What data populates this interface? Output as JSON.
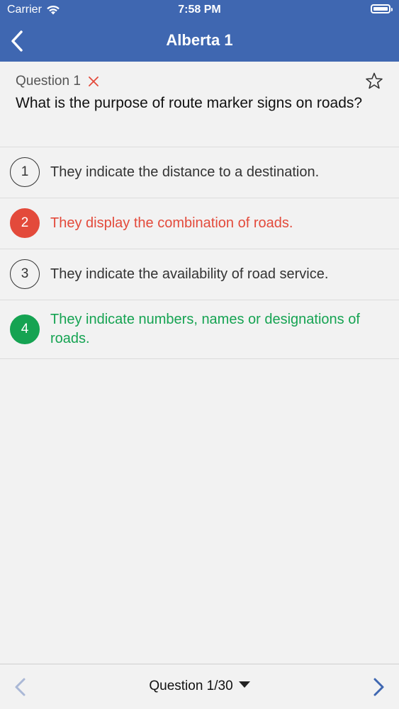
{
  "status_bar": {
    "carrier": "Carrier",
    "time": "7:58 PM"
  },
  "nav": {
    "title": "Alberta 1"
  },
  "question": {
    "label": "Question 1",
    "text": "What is the purpose of route marker signs on roads?"
  },
  "answers": [
    {
      "number": "1",
      "text": "They indicate the distance to a destination.",
      "state": "neutral"
    },
    {
      "number": "2",
      "text": "They display the combination of roads.",
      "state": "wrong"
    },
    {
      "number": "3",
      "text": "They indicate the availability of road service.",
      "state": "neutral"
    },
    {
      "number": "4",
      "text": "They indicate numbers, names or designations of roads.",
      "state": "correct"
    }
  ],
  "footer": {
    "selector_label": "Question 1/30"
  },
  "colors": {
    "nav_bg": "#3f67b1",
    "wrong": "#e34a3b",
    "correct": "#15a352",
    "nav_arrow": "#3f67b1",
    "nav_arrow_disabled": "#aab8d6"
  },
  "icons": [
    "wifi-icon",
    "battery-icon",
    "back-chevron-icon",
    "wrong-x-icon",
    "star-icon",
    "prev-chevron-icon",
    "next-chevron-icon",
    "dropdown-caret-icon"
  ]
}
